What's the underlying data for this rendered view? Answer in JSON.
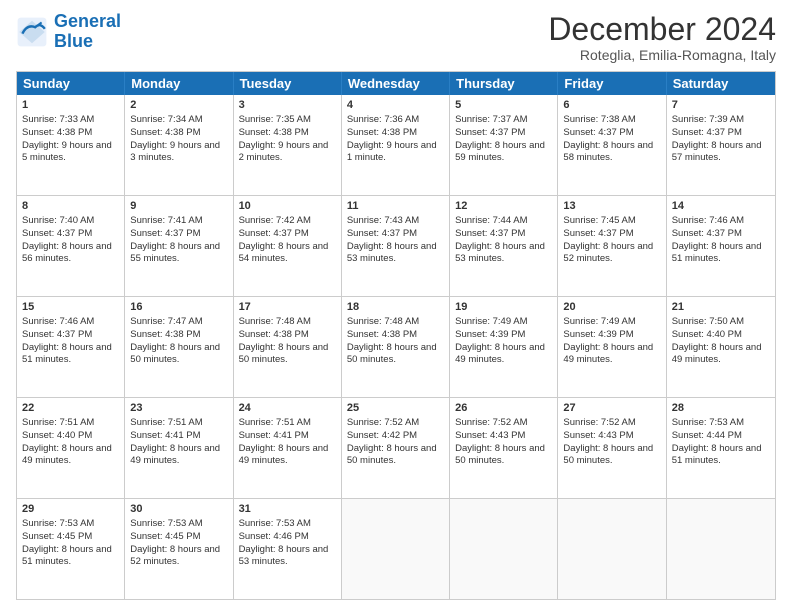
{
  "logo": {
    "line1": "General",
    "line2": "Blue"
  },
  "title": "December 2024",
  "subtitle": "Roteglia, Emilia-Romagna, Italy",
  "days": [
    "Sunday",
    "Monday",
    "Tuesday",
    "Wednesday",
    "Thursday",
    "Friday",
    "Saturday"
  ],
  "weeks": [
    [
      {
        "day": "1",
        "sunrise": "Sunrise: 7:33 AM",
        "sunset": "Sunset: 4:38 PM",
        "daylight": "Daylight: 9 hours and 5 minutes."
      },
      {
        "day": "2",
        "sunrise": "Sunrise: 7:34 AM",
        "sunset": "Sunset: 4:38 PM",
        "daylight": "Daylight: 9 hours and 3 minutes."
      },
      {
        "day": "3",
        "sunrise": "Sunrise: 7:35 AM",
        "sunset": "Sunset: 4:38 PM",
        "daylight": "Daylight: 9 hours and 2 minutes."
      },
      {
        "day": "4",
        "sunrise": "Sunrise: 7:36 AM",
        "sunset": "Sunset: 4:38 PM",
        "daylight": "Daylight: 9 hours and 1 minute."
      },
      {
        "day": "5",
        "sunrise": "Sunrise: 7:37 AM",
        "sunset": "Sunset: 4:37 PM",
        "daylight": "Daylight: 8 hours and 59 minutes."
      },
      {
        "day": "6",
        "sunrise": "Sunrise: 7:38 AM",
        "sunset": "Sunset: 4:37 PM",
        "daylight": "Daylight: 8 hours and 58 minutes."
      },
      {
        "day": "7",
        "sunrise": "Sunrise: 7:39 AM",
        "sunset": "Sunset: 4:37 PM",
        "daylight": "Daylight: 8 hours and 57 minutes."
      }
    ],
    [
      {
        "day": "8",
        "sunrise": "Sunrise: 7:40 AM",
        "sunset": "Sunset: 4:37 PM",
        "daylight": "Daylight: 8 hours and 56 minutes."
      },
      {
        "day": "9",
        "sunrise": "Sunrise: 7:41 AM",
        "sunset": "Sunset: 4:37 PM",
        "daylight": "Daylight: 8 hours and 55 minutes."
      },
      {
        "day": "10",
        "sunrise": "Sunrise: 7:42 AM",
        "sunset": "Sunset: 4:37 PM",
        "daylight": "Daylight: 8 hours and 54 minutes."
      },
      {
        "day": "11",
        "sunrise": "Sunrise: 7:43 AM",
        "sunset": "Sunset: 4:37 PM",
        "daylight": "Daylight: 8 hours and 53 minutes."
      },
      {
        "day": "12",
        "sunrise": "Sunrise: 7:44 AM",
        "sunset": "Sunset: 4:37 PM",
        "daylight": "Daylight: 8 hours and 53 minutes."
      },
      {
        "day": "13",
        "sunrise": "Sunrise: 7:45 AM",
        "sunset": "Sunset: 4:37 PM",
        "daylight": "Daylight: 8 hours and 52 minutes."
      },
      {
        "day": "14",
        "sunrise": "Sunrise: 7:46 AM",
        "sunset": "Sunset: 4:37 PM",
        "daylight": "Daylight: 8 hours and 51 minutes."
      }
    ],
    [
      {
        "day": "15",
        "sunrise": "Sunrise: 7:46 AM",
        "sunset": "Sunset: 4:37 PM",
        "daylight": "Daylight: 8 hours and 51 minutes."
      },
      {
        "day": "16",
        "sunrise": "Sunrise: 7:47 AM",
        "sunset": "Sunset: 4:38 PM",
        "daylight": "Daylight: 8 hours and 50 minutes."
      },
      {
        "day": "17",
        "sunrise": "Sunrise: 7:48 AM",
        "sunset": "Sunset: 4:38 PM",
        "daylight": "Daylight: 8 hours and 50 minutes."
      },
      {
        "day": "18",
        "sunrise": "Sunrise: 7:48 AM",
        "sunset": "Sunset: 4:38 PM",
        "daylight": "Daylight: 8 hours and 50 minutes."
      },
      {
        "day": "19",
        "sunrise": "Sunrise: 7:49 AM",
        "sunset": "Sunset: 4:39 PM",
        "daylight": "Daylight: 8 hours and 49 minutes."
      },
      {
        "day": "20",
        "sunrise": "Sunrise: 7:49 AM",
        "sunset": "Sunset: 4:39 PM",
        "daylight": "Daylight: 8 hours and 49 minutes."
      },
      {
        "day": "21",
        "sunrise": "Sunrise: 7:50 AM",
        "sunset": "Sunset: 4:40 PM",
        "daylight": "Daylight: 8 hours and 49 minutes."
      }
    ],
    [
      {
        "day": "22",
        "sunrise": "Sunrise: 7:51 AM",
        "sunset": "Sunset: 4:40 PM",
        "daylight": "Daylight: 8 hours and 49 minutes."
      },
      {
        "day": "23",
        "sunrise": "Sunrise: 7:51 AM",
        "sunset": "Sunset: 4:41 PM",
        "daylight": "Daylight: 8 hours and 49 minutes."
      },
      {
        "day": "24",
        "sunrise": "Sunrise: 7:51 AM",
        "sunset": "Sunset: 4:41 PM",
        "daylight": "Daylight: 8 hours and 49 minutes."
      },
      {
        "day": "25",
        "sunrise": "Sunrise: 7:52 AM",
        "sunset": "Sunset: 4:42 PM",
        "daylight": "Daylight: 8 hours and 50 minutes."
      },
      {
        "day": "26",
        "sunrise": "Sunrise: 7:52 AM",
        "sunset": "Sunset: 4:43 PM",
        "daylight": "Daylight: 8 hours and 50 minutes."
      },
      {
        "day": "27",
        "sunrise": "Sunrise: 7:52 AM",
        "sunset": "Sunset: 4:43 PM",
        "daylight": "Daylight: 8 hours and 50 minutes."
      },
      {
        "day": "28",
        "sunrise": "Sunrise: 7:53 AM",
        "sunset": "Sunset: 4:44 PM",
        "daylight": "Daylight: 8 hours and 51 minutes."
      }
    ],
    [
      {
        "day": "29",
        "sunrise": "Sunrise: 7:53 AM",
        "sunset": "Sunset: 4:45 PM",
        "daylight": "Daylight: 8 hours and 51 minutes."
      },
      {
        "day": "30",
        "sunrise": "Sunrise: 7:53 AM",
        "sunset": "Sunset: 4:45 PM",
        "daylight": "Daylight: 8 hours and 52 minutes."
      },
      {
        "day": "31",
        "sunrise": "Sunrise: 7:53 AM",
        "sunset": "Sunset: 4:46 PM",
        "daylight": "Daylight: 8 hours and 53 minutes."
      },
      null,
      null,
      null,
      null
    ]
  ]
}
